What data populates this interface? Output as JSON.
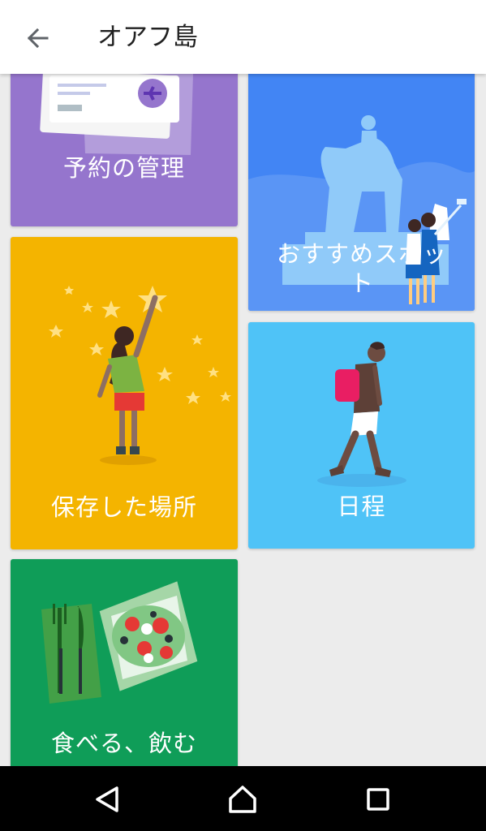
{
  "app_bar": {
    "title": "オアフ島",
    "back_icon": "arrow-back-icon"
  },
  "cards": {
    "reservations": {
      "label": "予約の管理",
      "color": "#9575cd",
      "icon": "boarding-pass-illustration"
    },
    "recommended": {
      "label": "おすすめスポット",
      "color": "#4285f4",
      "icon": "statue-selfie-illustration"
    },
    "saved": {
      "label": "保存した場所",
      "color": "#f4b400",
      "icon": "girl-reaching-stars-illustration"
    },
    "itinerary": {
      "label": "日程",
      "color": "#4fc3f7",
      "icon": "walking-traveler-illustration"
    },
    "food": {
      "label": "食べる、飲む",
      "color": "#0f9d58",
      "icon": "salad-plate-illustration"
    }
  },
  "nav_bar": {
    "back": "triangle-back-icon",
    "home": "home-icon",
    "recents": "square-recents-icon"
  }
}
